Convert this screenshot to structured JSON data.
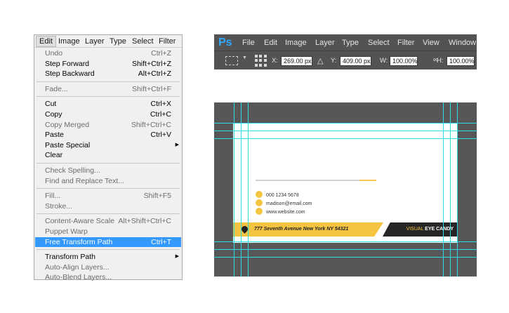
{
  "menubar": {
    "items": [
      "Edit",
      "Image",
      "Layer",
      "Type",
      "Select",
      "Filter"
    ]
  },
  "edit_menu": {
    "items": [
      {
        "label": "Undo",
        "shortcut": "Ctrl+Z",
        "state": "disabled"
      },
      {
        "label": "Step Forward",
        "shortcut": "Shift+Ctrl+Z",
        "state": "enabled"
      },
      {
        "label": "Step Backward",
        "shortcut": "Alt+Ctrl+Z",
        "state": "enabled"
      },
      {
        "label": "Fade...",
        "shortcut": "Shift+Ctrl+F",
        "state": "disabled"
      },
      {
        "label": "Cut",
        "shortcut": "Ctrl+X",
        "state": "enabled"
      },
      {
        "label": "Copy",
        "shortcut": "Ctrl+C",
        "state": "enabled"
      },
      {
        "label": "Copy Merged",
        "shortcut": "Shift+Ctrl+C",
        "state": "disabled"
      },
      {
        "label": "Paste",
        "shortcut": "Ctrl+V",
        "state": "enabled"
      },
      {
        "label": "Paste Special",
        "shortcut": "",
        "state": "enabled",
        "submenu": true
      },
      {
        "label": "Clear",
        "shortcut": "",
        "state": "enabled"
      },
      {
        "label": "Check Spelling...",
        "shortcut": "",
        "state": "disabled"
      },
      {
        "label": "Find and Replace Text...",
        "shortcut": "",
        "state": "disabled"
      },
      {
        "label": "Fill...",
        "shortcut": "Shift+F5",
        "state": "disabled"
      },
      {
        "label": "Stroke...",
        "shortcut": "",
        "state": "disabled"
      },
      {
        "label": "Content-Aware Scale",
        "shortcut": "Alt+Shift+Ctrl+C",
        "state": "disabled"
      },
      {
        "label": "Puppet Warp",
        "shortcut": "",
        "state": "disabled"
      },
      {
        "label": "Free Transform Path",
        "shortcut": "Ctrl+T",
        "state": "highlighted"
      },
      {
        "label": "Transform Path",
        "shortcut": "",
        "state": "enabled",
        "submenu": true
      },
      {
        "label": "Auto-Align Layers...",
        "shortcut": "",
        "state": "disabled"
      },
      {
        "label": "Auto-Blend Layers...",
        "shortcut": "",
        "state": "disabled"
      }
    ]
  },
  "ps": {
    "logo": "Ps",
    "menu": [
      "File",
      "Edit",
      "Image",
      "Layer",
      "Type",
      "Select",
      "Filter",
      "View",
      "Window"
    ],
    "options": {
      "x_label": "X:",
      "x_value": "269.00 px",
      "y_label": "Y:",
      "y_value": "409.00 px",
      "w_label": "W:",
      "w_value": "100.00%",
      "h_label": "H:",
      "h_value": "100.00%"
    }
  },
  "card": {
    "phone": "000 1234 5678",
    "email": "madison@email.com",
    "website": "www.website.com",
    "address": "777 Seventh Avenue New York NY 54321",
    "brand_light": "VISUAL ",
    "brand_bold": "EYE CANDY",
    "progress_fraction": 0.14
  },
  "colors": {
    "highlight": "#3399ff",
    "ps_accent": "#31a8ff",
    "card_yellow": "#f5c542",
    "card_dark": "#262626",
    "guide": "#27e0e6"
  },
  "icons": {
    "tool": "move-transform-icon",
    "reference_point": "reference-point-grid-icon",
    "delta": "delta-icon",
    "link": "link-icon",
    "location": "location-pin-icon"
  }
}
